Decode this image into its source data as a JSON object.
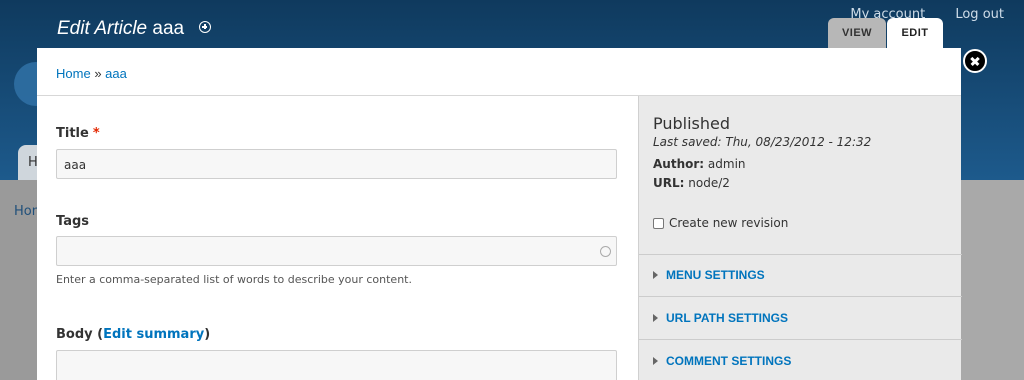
{
  "site": {
    "top_links": [
      "My account",
      "Log out"
    ],
    "tab_label": "H",
    "breadcrumb_partial": "Hom"
  },
  "overlay": {
    "title_prefix": "Edit Article",
    "title_name": "aaa",
    "tabs": {
      "view": "VIEW",
      "edit": "EDIT"
    }
  },
  "breadcrumb": {
    "home": "Home",
    "separator": "»",
    "current": "aaa"
  },
  "form": {
    "title_label": "Title",
    "title_required": "*",
    "title_value": "aaa",
    "tags_label": "Tags",
    "tags_value": "",
    "tags_description": "Enter a comma-separated list of words to describe your content.",
    "body_label_prefix": "Body (",
    "body_edit_summary": "Edit summary",
    "body_label_suffix": ")"
  },
  "sidebar": {
    "status": "Published",
    "last_saved": "Last saved: Thu, 08/23/2012 - 12:32",
    "author_label": "Author:",
    "author_value": "admin",
    "url_label": "URL:",
    "url_value": "node/2",
    "revision_label": "Create new revision",
    "sections": [
      "MENU SETTINGS",
      "URL PATH SETTINGS",
      "COMMENT SETTINGS"
    ]
  },
  "colors": {
    "link": "#0074bd",
    "required": "#e32700",
    "header_bg": "#0f3a5e"
  },
  "icons": {
    "add": "plus-circle-icon",
    "close": "close-icon",
    "throbber": "autocomplete-icon",
    "section": "triangle-right-icon"
  }
}
